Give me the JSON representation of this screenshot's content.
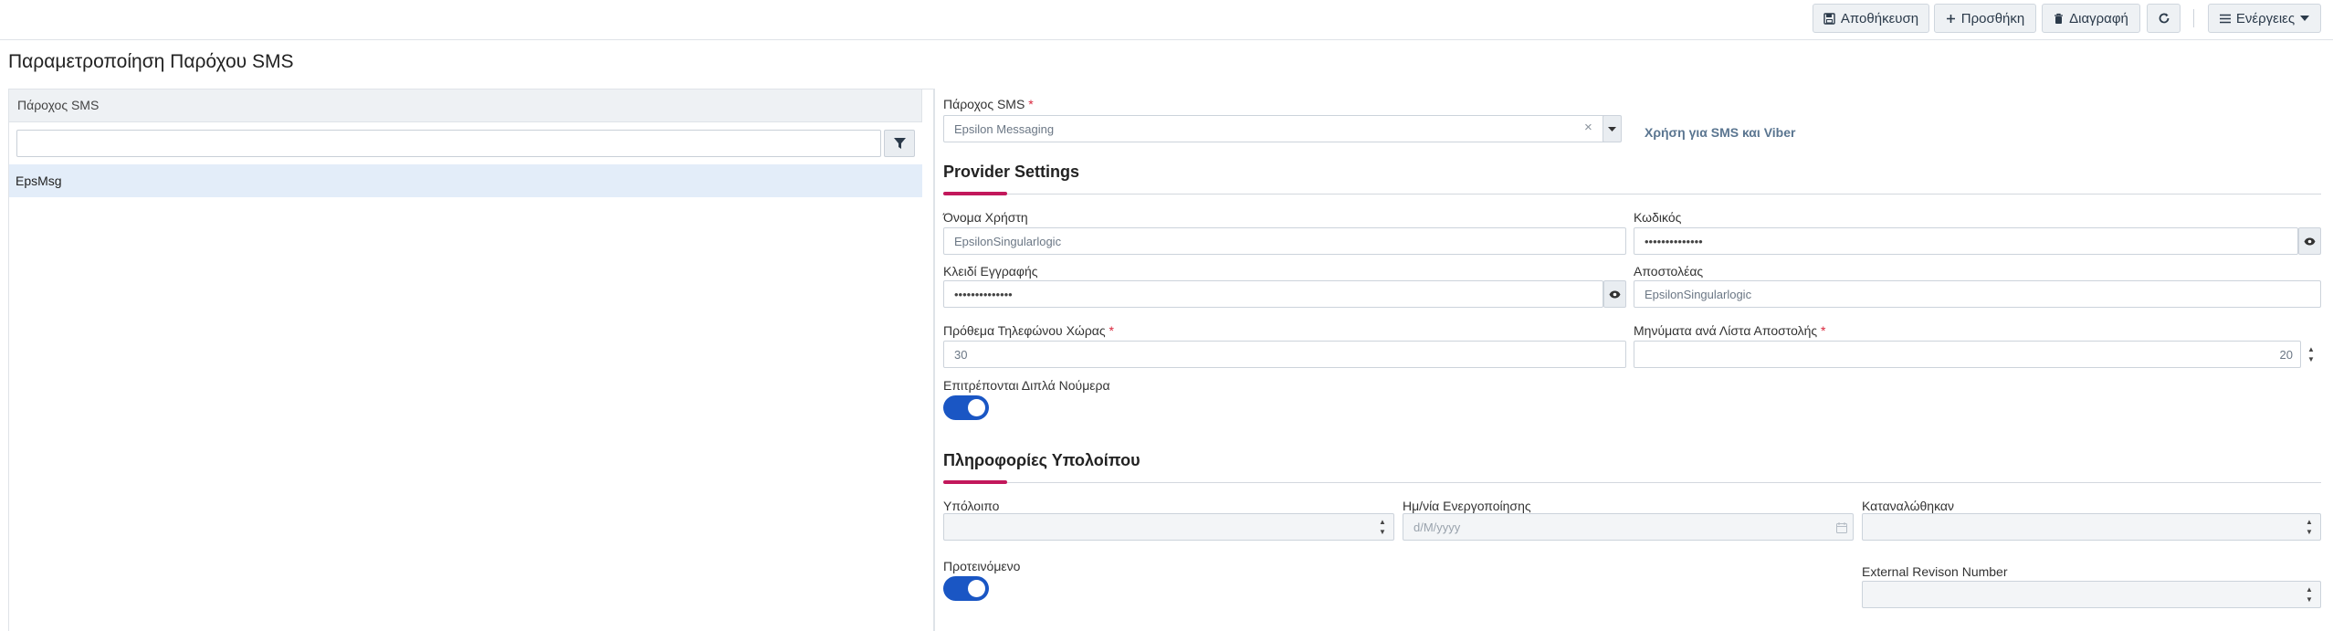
{
  "toolbar": {
    "save_label": "Αποθήκευση",
    "add_label": "Προσθήκη",
    "delete_label": "Διαγραφή",
    "actions_label": "Ενέργειες"
  },
  "page": {
    "title": "Παραμετροποίηση Παρόχου SMS"
  },
  "list": {
    "header": "Πάροχος SMS",
    "filter_placeholder": "",
    "rows": [
      "EpsMsg"
    ]
  },
  "form": {
    "provider_label": "Πάροχος SMS",
    "provider_value": "Epsilon Messaging",
    "sms_viber_link": "Χρήση για SMS και Viber",
    "provider_settings_title": "Provider Settings",
    "username_label": "Όνομα Χρήστη",
    "username_value": "EpsilonSingularlogic",
    "password_label": "Κωδικός",
    "password_value": "••••••••••••••",
    "regkey_label": "Κλειδί Εγγραφής",
    "regkey_value": "••••••••••••••",
    "sender_label": "Αποστολέας",
    "sender_value": "EpsilonSingularlogic",
    "country_prefix_label": "Πρόθεμα Τηλεφώνου Χώρας",
    "country_prefix_value": "30",
    "messages_per_list_label": "Μηνύματα ανά Λίστα Αποστολής",
    "messages_per_list_value": "20",
    "allow_duplicates_label": "Επιτρέπονται Διπλά Νούμερα",
    "allow_duplicates_on": true,
    "balance_section_title": "Πληροφορίες Υπολοίπου",
    "balance_label": "Υπόλοιπο",
    "balance_value": "",
    "activation_date_label": "Ημ/νία Ενεργοποίησης",
    "activation_date_placeholder": "d/M/yyyy",
    "consumed_label": "Καταναλώθηκαν",
    "consumed_value": "",
    "recommended_label": "Προτεινόμενο",
    "recommended_on": true,
    "ext_revision_label": "External Revison Number",
    "ext_revision_value": ""
  },
  "colors": {
    "accent": "#c2185b",
    "toggle": "#1a56c4",
    "selected_row": "#e3edf9"
  }
}
